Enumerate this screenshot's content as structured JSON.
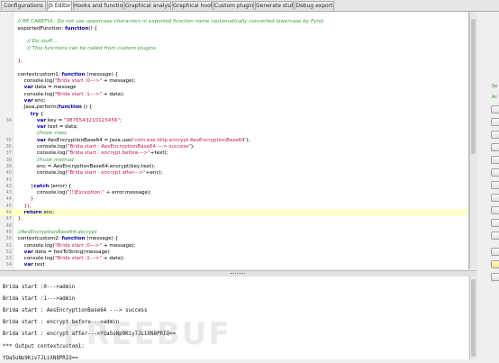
{
  "tabs": [
    {
      "label": "Configurations",
      "active": false
    },
    {
      "label": "JS Editor",
      "active": true
    },
    {
      "label": "Hooks and functions",
      "active": false
    },
    {
      "label": "Graphical analysis",
      "active": false
    },
    {
      "label": "Graphical hooks",
      "active": false
    },
    {
      "label": "Custom plugins",
      "active": false
    },
    {
      "label": "Generate stubs",
      "active": false
    },
    {
      "label": "Debug export",
      "active": false
    }
  ],
  "editor": {
    "highlighted_line": 46,
    "lines": [
      {
        "n": "",
        "segs": []
      },
      {
        "n": "",
        "segs": [
          {
            "t": "  // BE CAREFUL: Do not use uppercase characters in exported function name (automatically converted lowercase by Pyro)",
            "c": "com"
          }
        ]
      },
      {
        "n": "",
        "segs": [
          {
            "t": "  exportedFunction: ",
            "c": "plain"
          },
          {
            "t": "function",
            "c": "kw"
          },
          {
            "t": "() {",
            "c": "plain"
          }
        ]
      },
      {
        "n": "",
        "segs": []
      },
      {
        "n": "",
        "segs": [
          {
            "t": "        // Do stuff...",
            "c": "com"
          }
        ]
      },
      {
        "n": "",
        "segs": [
          {
            "t": "        // This functions can be called from custom plugins",
            "c": "com"
          }
        ]
      },
      {
        "n": "",
        "segs": []
      },
      {
        "n": "",
        "segs": [
          {
            "t": "  },",
            "c": "br"
          }
        ]
      },
      {
        "n": "",
        "segs": []
      },
      {
        "n": "",
        "segs": [
          {
            "t": "  contextcustom1: ",
            "c": "plain"
          },
          {
            "t": "function",
            "c": "kw"
          },
          {
            "t": " (message) {",
            "c": "plain"
          }
        ]
      },
      {
        "n": "",
        "segs": [
          {
            "t": "      console.log(",
            "c": "plain"
          },
          {
            "t": "\"Brida start :0--->\"",
            "c": "str"
          },
          {
            "t": " + message);",
            "c": "plain"
          }
        ]
      },
      {
        "n": "",
        "segs": [
          {
            "t": "      ",
            "c": "plain"
          },
          {
            "t": "var",
            "c": "kw"
          },
          {
            "t": " data = message",
            "c": "plain"
          }
        ]
      },
      {
        "n": "",
        "segs": [
          {
            "t": "      console.log(",
            "c": "plain"
          },
          {
            "t": "\"Brida start :1--->\"",
            "c": "str"
          },
          {
            "t": " + data);",
            "c": "plain"
          }
        ]
      },
      {
        "n": "",
        "segs": [
          {
            "t": "      ",
            "c": "plain"
          },
          {
            "t": "var",
            "c": "kw"
          },
          {
            "t": " enc;",
            "c": "plain"
          }
        ]
      },
      {
        "n": "",
        "segs": [
          {
            "t": "      Java.perform(",
            "c": "plain"
          },
          {
            "t": "function",
            "c": "kw"
          },
          {
            "t": " () {",
            "c": "plain"
          }
        ]
      },
      {
        "n": "",
        "segs": [
          {
            "t": "          ",
            "c": "plain"
          },
          {
            "t": "try",
            "c": "kw"
          },
          {
            "t": " {",
            "c": "plain"
          }
        ]
      },
      {
        "n": "34",
        "segs": [
          {
            "t": "              ",
            "c": "plain"
          },
          {
            "t": "var",
            "c": "kw"
          },
          {
            "t": " key = ",
            "c": "plain"
          },
          {
            "t": "\"9876543210123456\"",
            "c": "str"
          },
          {
            "t": ";",
            "c": "plain"
          }
        ]
      },
      {
        "n": "",
        "segs": [
          {
            "t": "              ",
            "c": "plain"
          },
          {
            "t": "var",
            "c": "kw"
          },
          {
            "t": " text = data;",
            "c": "plain"
          }
        ]
      },
      {
        "n": "",
        "segs": [
          {
            "t": "              //hook class",
            "c": "com"
          }
        ]
      },
      {
        "n": "35",
        "segs": [
          {
            "t": "              ",
            "c": "plain"
          },
          {
            "t": "var",
            "c": "kw"
          },
          {
            "t": " AesEncryptionBase64 = Java.use(",
            "c": "plain"
          },
          {
            "t": "'com.ese.http.encrypt.AesEncryptionBase64'",
            "c": "str"
          },
          {
            "t": ");",
            "c": "plain"
          }
        ]
      },
      {
        "n": "36",
        "segs": [
          {
            "t": "              console.log(",
            "c": "plain"
          },
          {
            "t": "\"Brida start : AesEncryptionBase64 ---> success\"",
            "c": "str"
          },
          {
            "t": ");",
            "c": "plain"
          }
        ]
      },
      {
        "n": "37",
        "segs": [
          {
            "t": "              console.log(",
            "c": "plain"
          },
          {
            "t": "\"Brida start : encrypt before--->\"",
            "c": "str"
          },
          {
            "t": "+text);",
            "c": "plain"
          }
        ]
      },
      {
        "n": "38",
        "segs": [
          {
            "t": "              //hook method",
            "c": "com"
          }
        ]
      },
      {
        "n": "39",
        "segs": [
          {
            "t": "              enc = AesEncryptionBase64.encrypt(key,text);",
            "c": "plain"
          }
        ]
      },
      {
        "n": "40",
        "segs": [
          {
            "t": "              console.log(",
            "c": "plain"
          },
          {
            "t": "\"Brida start : encrypt after--->\"",
            "c": "str"
          },
          {
            "t": "+enc);",
            "c": "plain"
          }
        ]
      },
      {
        "n": "41",
        "segs": []
      },
      {
        "n": "42",
        "segs": [
          {
            "t": "          }",
            "c": "br"
          },
          {
            "t": "catch",
            "c": "kw"
          },
          {
            "t": " (error) {",
            "c": "plain"
          }
        ]
      },
      {
        "n": "43",
        "segs": [
          {
            "t": "              console.log(",
            "c": "plain"
          },
          {
            "t": "\"[!]Exception:\"",
            "c": "str"
          },
          {
            "t": " + error.message);",
            "c": "plain"
          }
        ]
      },
      {
        "n": "44",
        "segs": [
          {
            "t": "          }",
            "c": "br"
          }
        ]
      },
      {
        "n": "45",
        "segs": [
          {
            "t": "      });",
            "c": "br"
          }
        ]
      },
      {
        "n": "46",
        "segs": [
          {
            "t": "      ",
            "c": "plain"
          },
          {
            "t": "return",
            "c": "kw"
          },
          {
            "t": " enc;",
            "c": "plain"
          }
        ]
      },
      {
        "n": "47",
        "segs": [
          {
            "t": "  },",
            "c": "br"
          }
        ]
      },
      {
        "n": "48",
        "segs": []
      },
      {
        "n": "49",
        "segs": [
          {
            "t": "  //AesEncryptionBase64 decrypt",
            "c": "com"
          }
        ]
      },
      {
        "n": "50",
        "segs": [
          {
            "t": "  contextcustom2: ",
            "c": "plain"
          },
          {
            "t": "function",
            "c": "kw"
          },
          {
            "t": " (message) {",
            "c": "plain"
          }
        ]
      },
      {
        "n": "51",
        "segs": [
          {
            "t": "      console.log(",
            "c": "plain"
          },
          {
            "t": "\"Brida start :0--->\"",
            "c": "str"
          },
          {
            "t": " + message);",
            "c": "plain"
          }
        ]
      },
      {
        "n": "52",
        "segs": [
          {
            "t": "      ",
            "c": "plain"
          },
          {
            "t": "var",
            "c": "kw"
          },
          {
            "t": " data = hexToString(message)",
            "c": "plain"
          }
        ]
      },
      {
        "n": "53",
        "segs": [
          {
            "t": "      console.log(",
            "c": "plain"
          },
          {
            "t": "\"Brida start :1--->\"",
            "c": "str"
          },
          {
            "t": " + data);",
            "c": "plain"
          }
        ]
      },
      {
        "n": "54",
        "segs": [
          {
            "t": "      ",
            "c": "plain"
          },
          {
            "t": "var",
            "c": "kw"
          },
          {
            "t": " text",
            "c": "plain"
          }
        ]
      }
    ]
  },
  "console": {
    "lines": [
      "",
      "Brida start :0--->admin",
      "",
      "Brida start :1--->admin",
      "",
      "Brida start : AesEncryptionBase64 ---> success",
      "",
      "Brida start : encrypt before--->admin",
      "",
      "Brida start : encrypt after--->YQa5uNp9Kiy7JLiXN8PRIQ==",
      "",
      "*** Output contextcustom1:",
      "",
      "YQa5uNp9Kiy7JLiXN8PRIQ=="
    ],
    "watermark": "FREEBUF"
  },
  "right_panel": {
    "labels": [
      "Se",
      "Ac"
    ]
  }
}
